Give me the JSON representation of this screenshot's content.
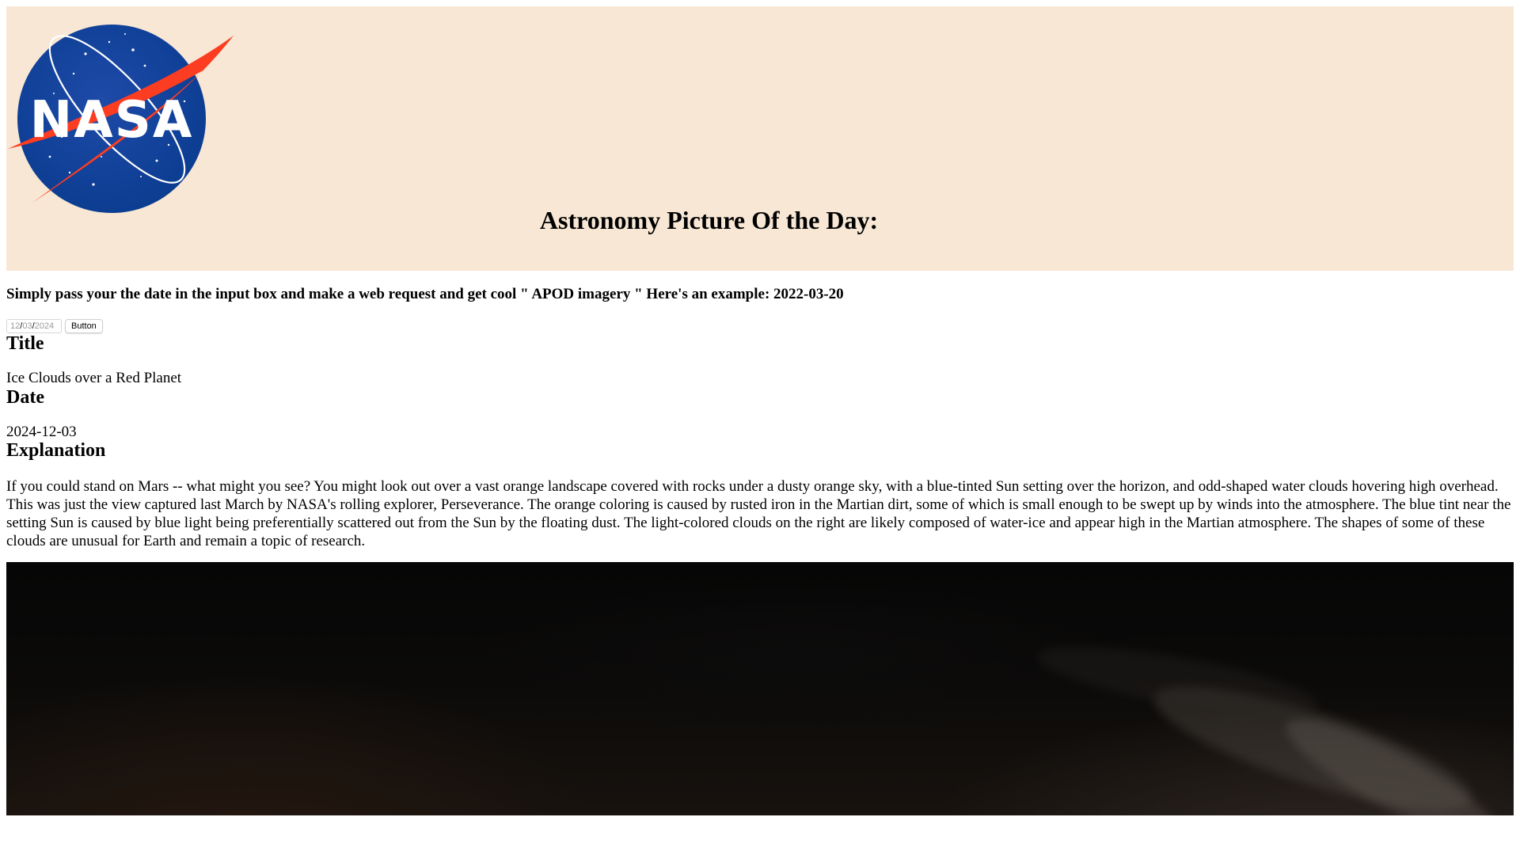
{
  "header": {
    "logo": {
      "text": "NASA",
      "colors": {
        "disc": "#0b3d91",
        "swoosh": "#fc3d21",
        "text": "#ffffff"
      }
    },
    "title": "Astronomy Picture Of the Day:",
    "background": "#f7e7d4"
  },
  "intro_text": "Simply pass your the date in the input box and make a web request and get cool \" APOD imagery \" Here's an example: 2022-03-20",
  "controls": {
    "date_input": {
      "month": "12",
      "day": "03",
      "year": "2024",
      "separator": "/"
    },
    "button_label": "Button"
  },
  "apod": {
    "title_heading": "Title",
    "title": "Ice Clouds over a Red Planet",
    "date_heading": "Date",
    "date": "2024-12-03",
    "explanation_heading": "Explanation",
    "explanation": "If you could stand on Mars -- what might you see? You might look out over a vast orange landscape covered with rocks under a dusty orange sky, with a blue-tinted Sun setting over the horizon, and odd-shaped water clouds hovering high overhead. This was just the view captured last March by NASA's rolling explorer, Perseverance. The orange coloring is caused by rusted iron in the Martian dirt, some of which is small enough to be swept up by winds into the atmosphere. The blue tint near the setting Sun is caused by blue light being preferentially scattered out from the Sun by the floating dust. The light-colored clouds on the right are likely composed of water-ice and appear high in the Martian atmosphere. The shapes of some of these clouds are unusual for Earth and remain a topic of research."
  }
}
